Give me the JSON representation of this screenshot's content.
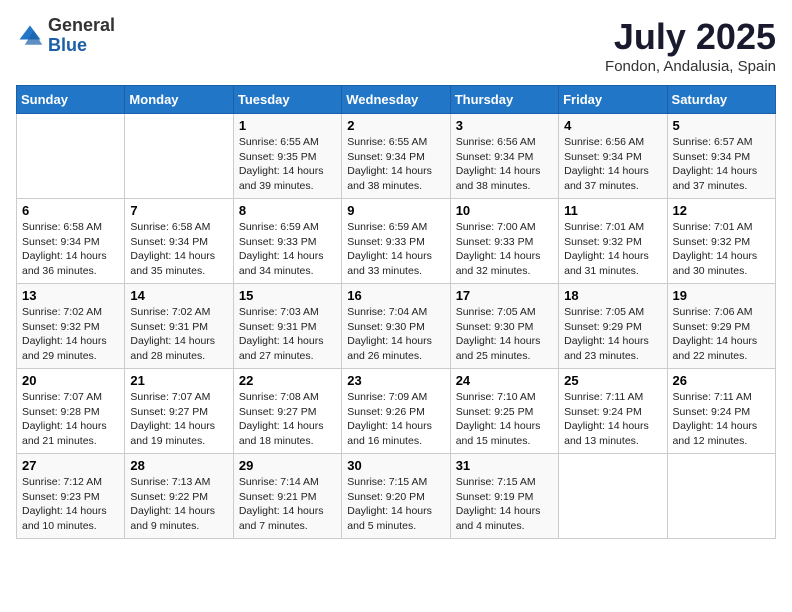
{
  "header": {
    "logo_general": "General",
    "logo_blue": "Blue",
    "title": "July 2025",
    "location": "Fondon, Andalusia, Spain"
  },
  "days_of_week": [
    "Sunday",
    "Monday",
    "Tuesday",
    "Wednesday",
    "Thursday",
    "Friday",
    "Saturday"
  ],
  "weeks": [
    [
      {
        "day": "",
        "sunrise": "",
        "sunset": "",
        "daylight": ""
      },
      {
        "day": "",
        "sunrise": "",
        "sunset": "",
        "daylight": ""
      },
      {
        "day": "1",
        "sunrise": "Sunrise: 6:55 AM",
        "sunset": "Sunset: 9:35 PM",
        "daylight": "Daylight: 14 hours and 39 minutes."
      },
      {
        "day": "2",
        "sunrise": "Sunrise: 6:55 AM",
        "sunset": "Sunset: 9:34 PM",
        "daylight": "Daylight: 14 hours and 38 minutes."
      },
      {
        "day": "3",
        "sunrise": "Sunrise: 6:56 AM",
        "sunset": "Sunset: 9:34 PM",
        "daylight": "Daylight: 14 hours and 38 minutes."
      },
      {
        "day": "4",
        "sunrise": "Sunrise: 6:56 AM",
        "sunset": "Sunset: 9:34 PM",
        "daylight": "Daylight: 14 hours and 37 minutes."
      },
      {
        "day": "5",
        "sunrise": "Sunrise: 6:57 AM",
        "sunset": "Sunset: 9:34 PM",
        "daylight": "Daylight: 14 hours and 37 minutes."
      }
    ],
    [
      {
        "day": "6",
        "sunrise": "Sunrise: 6:58 AM",
        "sunset": "Sunset: 9:34 PM",
        "daylight": "Daylight: 14 hours and 36 minutes."
      },
      {
        "day": "7",
        "sunrise": "Sunrise: 6:58 AM",
        "sunset": "Sunset: 9:34 PM",
        "daylight": "Daylight: 14 hours and 35 minutes."
      },
      {
        "day": "8",
        "sunrise": "Sunrise: 6:59 AM",
        "sunset": "Sunset: 9:33 PM",
        "daylight": "Daylight: 14 hours and 34 minutes."
      },
      {
        "day": "9",
        "sunrise": "Sunrise: 6:59 AM",
        "sunset": "Sunset: 9:33 PM",
        "daylight": "Daylight: 14 hours and 33 minutes."
      },
      {
        "day": "10",
        "sunrise": "Sunrise: 7:00 AM",
        "sunset": "Sunset: 9:33 PM",
        "daylight": "Daylight: 14 hours and 32 minutes."
      },
      {
        "day": "11",
        "sunrise": "Sunrise: 7:01 AM",
        "sunset": "Sunset: 9:32 PM",
        "daylight": "Daylight: 14 hours and 31 minutes."
      },
      {
        "day": "12",
        "sunrise": "Sunrise: 7:01 AM",
        "sunset": "Sunset: 9:32 PM",
        "daylight": "Daylight: 14 hours and 30 minutes."
      }
    ],
    [
      {
        "day": "13",
        "sunrise": "Sunrise: 7:02 AM",
        "sunset": "Sunset: 9:32 PM",
        "daylight": "Daylight: 14 hours and 29 minutes."
      },
      {
        "day": "14",
        "sunrise": "Sunrise: 7:02 AM",
        "sunset": "Sunset: 9:31 PM",
        "daylight": "Daylight: 14 hours and 28 minutes."
      },
      {
        "day": "15",
        "sunrise": "Sunrise: 7:03 AM",
        "sunset": "Sunset: 9:31 PM",
        "daylight": "Daylight: 14 hours and 27 minutes."
      },
      {
        "day": "16",
        "sunrise": "Sunrise: 7:04 AM",
        "sunset": "Sunset: 9:30 PM",
        "daylight": "Daylight: 14 hours and 26 minutes."
      },
      {
        "day": "17",
        "sunrise": "Sunrise: 7:05 AM",
        "sunset": "Sunset: 9:30 PM",
        "daylight": "Daylight: 14 hours and 25 minutes."
      },
      {
        "day": "18",
        "sunrise": "Sunrise: 7:05 AM",
        "sunset": "Sunset: 9:29 PM",
        "daylight": "Daylight: 14 hours and 23 minutes."
      },
      {
        "day": "19",
        "sunrise": "Sunrise: 7:06 AM",
        "sunset": "Sunset: 9:29 PM",
        "daylight": "Daylight: 14 hours and 22 minutes."
      }
    ],
    [
      {
        "day": "20",
        "sunrise": "Sunrise: 7:07 AM",
        "sunset": "Sunset: 9:28 PM",
        "daylight": "Daylight: 14 hours and 21 minutes."
      },
      {
        "day": "21",
        "sunrise": "Sunrise: 7:07 AM",
        "sunset": "Sunset: 9:27 PM",
        "daylight": "Daylight: 14 hours and 19 minutes."
      },
      {
        "day": "22",
        "sunrise": "Sunrise: 7:08 AM",
        "sunset": "Sunset: 9:27 PM",
        "daylight": "Daylight: 14 hours and 18 minutes."
      },
      {
        "day": "23",
        "sunrise": "Sunrise: 7:09 AM",
        "sunset": "Sunset: 9:26 PM",
        "daylight": "Daylight: 14 hours and 16 minutes."
      },
      {
        "day": "24",
        "sunrise": "Sunrise: 7:10 AM",
        "sunset": "Sunset: 9:25 PM",
        "daylight": "Daylight: 14 hours and 15 minutes."
      },
      {
        "day": "25",
        "sunrise": "Sunrise: 7:11 AM",
        "sunset": "Sunset: 9:24 PM",
        "daylight": "Daylight: 14 hours and 13 minutes."
      },
      {
        "day": "26",
        "sunrise": "Sunrise: 7:11 AM",
        "sunset": "Sunset: 9:24 PM",
        "daylight": "Daylight: 14 hours and 12 minutes."
      }
    ],
    [
      {
        "day": "27",
        "sunrise": "Sunrise: 7:12 AM",
        "sunset": "Sunset: 9:23 PM",
        "daylight": "Daylight: 14 hours and 10 minutes."
      },
      {
        "day": "28",
        "sunrise": "Sunrise: 7:13 AM",
        "sunset": "Sunset: 9:22 PM",
        "daylight": "Daylight: 14 hours and 9 minutes."
      },
      {
        "day": "29",
        "sunrise": "Sunrise: 7:14 AM",
        "sunset": "Sunset: 9:21 PM",
        "daylight": "Daylight: 14 hours and 7 minutes."
      },
      {
        "day": "30",
        "sunrise": "Sunrise: 7:15 AM",
        "sunset": "Sunset: 9:20 PM",
        "daylight": "Daylight: 14 hours and 5 minutes."
      },
      {
        "day": "31",
        "sunrise": "Sunrise: 7:15 AM",
        "sunset": "Sunset: 9:19 PM",
        "daylight": "Daylight: 14 hours and 4 minutes."
      },
      {
        "day": "",
        "sunrise": "",
        "sunset": "",
        "daylight": ""
      },
      {
        "day": "",
        "sunrise": "",
        "sunset": "",
        "daylight": ""
      }
    ]
  ]
}
